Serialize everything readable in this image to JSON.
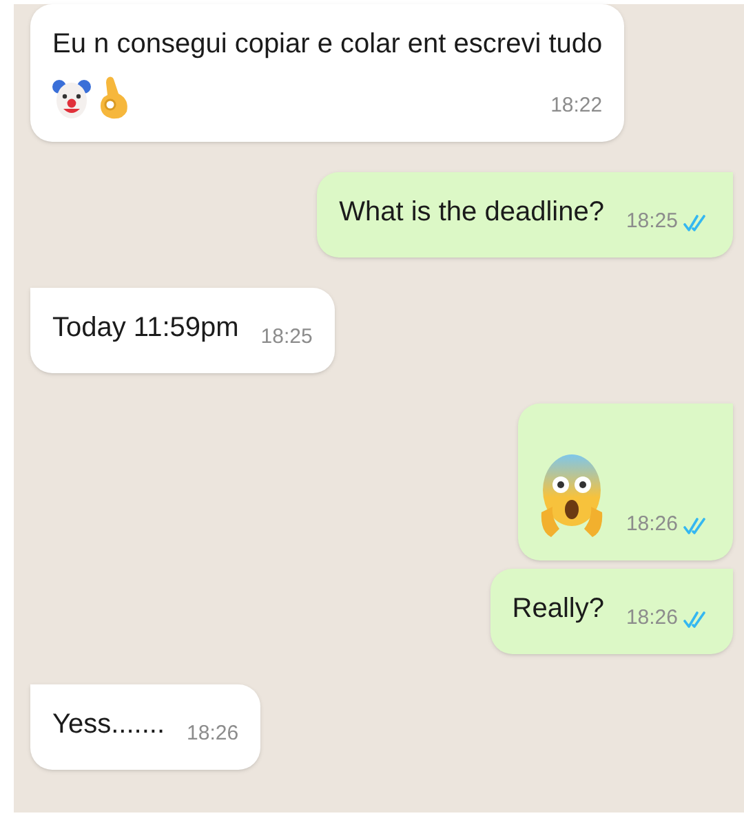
{
  "messages": [
    {
      "outgoing": false,
      "kind": "text_with_emoji",
      "text": "Eu n consegui copiar e colar ent escrevi tudo",
      "time": "18:22"
    },
    {
      "outgoing": true,
      "kind": "text",
      "text": "What is the deadline?",
      "time": "18:25",
      "read": true
    },
    {
      "outgoing": false,
      "kind": "text",
      "text": "Today 11:59pm",
      "time": "18:25",
      "tail": true
    },
    {
      "outgoing": true,
      "kind": "emoji",
      "time": "18:26",
      "read": true
    },
    {
      "outgoing": true,
      "kind": "text",
      "text": "Really?",
      "time": "18:26",
      "read": true
    },
    {
      "outgoing": false,
      "kind": "text",
      "text": "Yess.......",
      "time": "18:26",
      "tail": true
    }
  ]
}
